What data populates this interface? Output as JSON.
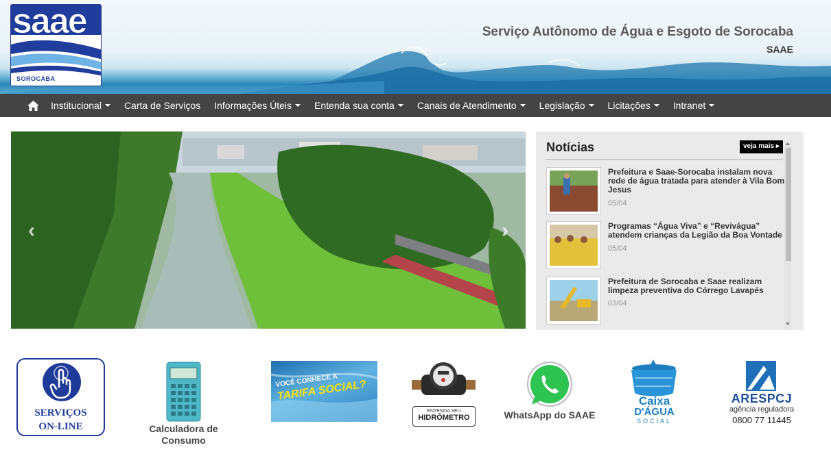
{
  "header": {
    "logo_word": "saae",
    "logo_city": "SOROCABA",
    "title": "Serviço Autônomo de Água e Esgoto de Sorocaba",
    "subtitle": "SAAE"
  },
  "nav": {
    "home_icon": "home-icon",
    "items": [
      {
        "label": "Institucional",
        "dropdown": true
      },
      {
        "label": "Carta de Serviços",
        "dropdown": false
      },
      {
        "label": "Informações Úteis",
        "dropdown": true
      },
      {
        "label": "Entenda sua conta",
        "dropdown": true
      },
      {
        "label": "Canais de Atendimento",
        "dropdown": true
      },
      {
        "label": "Legislação",
        "dropdown": true
      },
      {
        "label": "Licitações",
        "dropdown": true
      },
      {
        "label": "Intranet",
        "dropdown": true
      }
    ]
  },
  "slider": {
    "prev_icon": "chevron-left-icon",
    "next_icon": "chevron-right-icon",
    "prev_glyph": "‹",
    "next_glyph": "›"
  },
  "news": {
    "title": "Notícias",
    "more_label": "veja mais ▸",
    "items": [
      {
        "headline": "Prefeitura e Saae-Sorocaba instalam nova rede de água tratada para atender à Vila Bom Jesus",
        "date": "05/04"
      },
      {
        "headline": "Programas “Água Viva” e “Revivágua” atendem crianças da Legião da Boa Vontade",
        "date": "05/04"
      },
      {
        "headline": "Prefeitura de Sorocaba e Saae realizam limpeza preventiva do Córrego Lavapés",
        "date": "03/04"
      }
    ]
  },
  "quick_links": {
    "servicos_line1": "SERVIÇOS",
    "servicos_line2": "ON-LINE",
    "calc_label_1": "Calculadora de",
    "calc_label_2": "Consumo",
    "tarifa_text_1": "VOCÊ CONHECE A",
    "tarifa_text_2": "TARIFA SOCIAL?",
    "hidrometro_1": "ENTENDA SEU",
    "hidrometro_2": "HIDRÔMETRO",
    "whatsapp_label": "WhatsApp do SAAE",
    "caixa_1": "Caixa",
    "caixa_2": "D'ÁGUA",
    "caixa_3": "SOCIAL",
    "ares_1": "ARESPCJ",
    "ares_2": "agência reguladora",
    "ares_phone": "0800 77 11445"
  },
  "colors": {
    "nav_bg": "#444444",
    "brand_blue": "#1f3b9a",
    "news_bg": "#eaeaea"
  }
}
